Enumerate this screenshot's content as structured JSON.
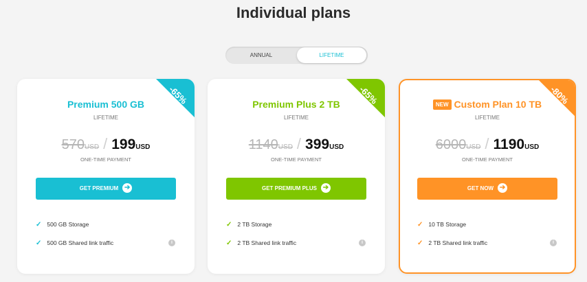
{
  "page": {
    "title": "Individual plans"
  },
  "toggle": {
    "annual": "ANNUAL",
    "lifetime": "LIFETIME"
  },
  "plans": [
    {
      "discount": "-65%",
      "name": "Premium 500 GB",
      "period": "LIFETIME",
      "old_price": "570",
      "old_currency": "USD",
      "separator": "/",
      "new_price": "199",
      "new_currency": "USD",
      "payment_type": "ONE-TIME PAYMENT",
      "cta": "GET PREMIUM",
      "features": [
        "500 GB Storage",
        "500 GB Shared link traffic"
      ],
      "accent": "#19bfd3"
    },
    {
      "discount": "-65%",
      "name": "Premium Plus 2 TB",
      "period": "LIFETIME",
      "old_price": "1140",
      "old_currency": "USD",
      "separator": "/",
      "new_price": "399",
      "new_currency": "USD",
      "payment_type": "ONE-TIME PAYMENT",
      "cta": "GET PREMIUM PLUS",
      "features": [
        "2 TB Storage",
        "2 TB Shared link traffic"
      ],
      "accent": "#7fc600"
    },
    {
      "badge": "NEW",
      "discount": "-80%",
      "name": "Custom Plan 10 TB",
      "period": "LIFETIME",
      "old_price": "6000",
      "old_currency": "USD",
      "separator": "/",
      "new_price": "1190",
      "new_currency": "USD",
      "payment_type": "ONE-TIME PAYMENT",
      "cta": "GET NOW",
      "features": [
        "10 TB Storage",
        "2 TB Shared link traffic"
      ],
      "accent": "#ff9326"
    }
  ],
  "icons": {
    "check": "✓",
    "arrow": "➔",
    "info": "i"
  }
}
